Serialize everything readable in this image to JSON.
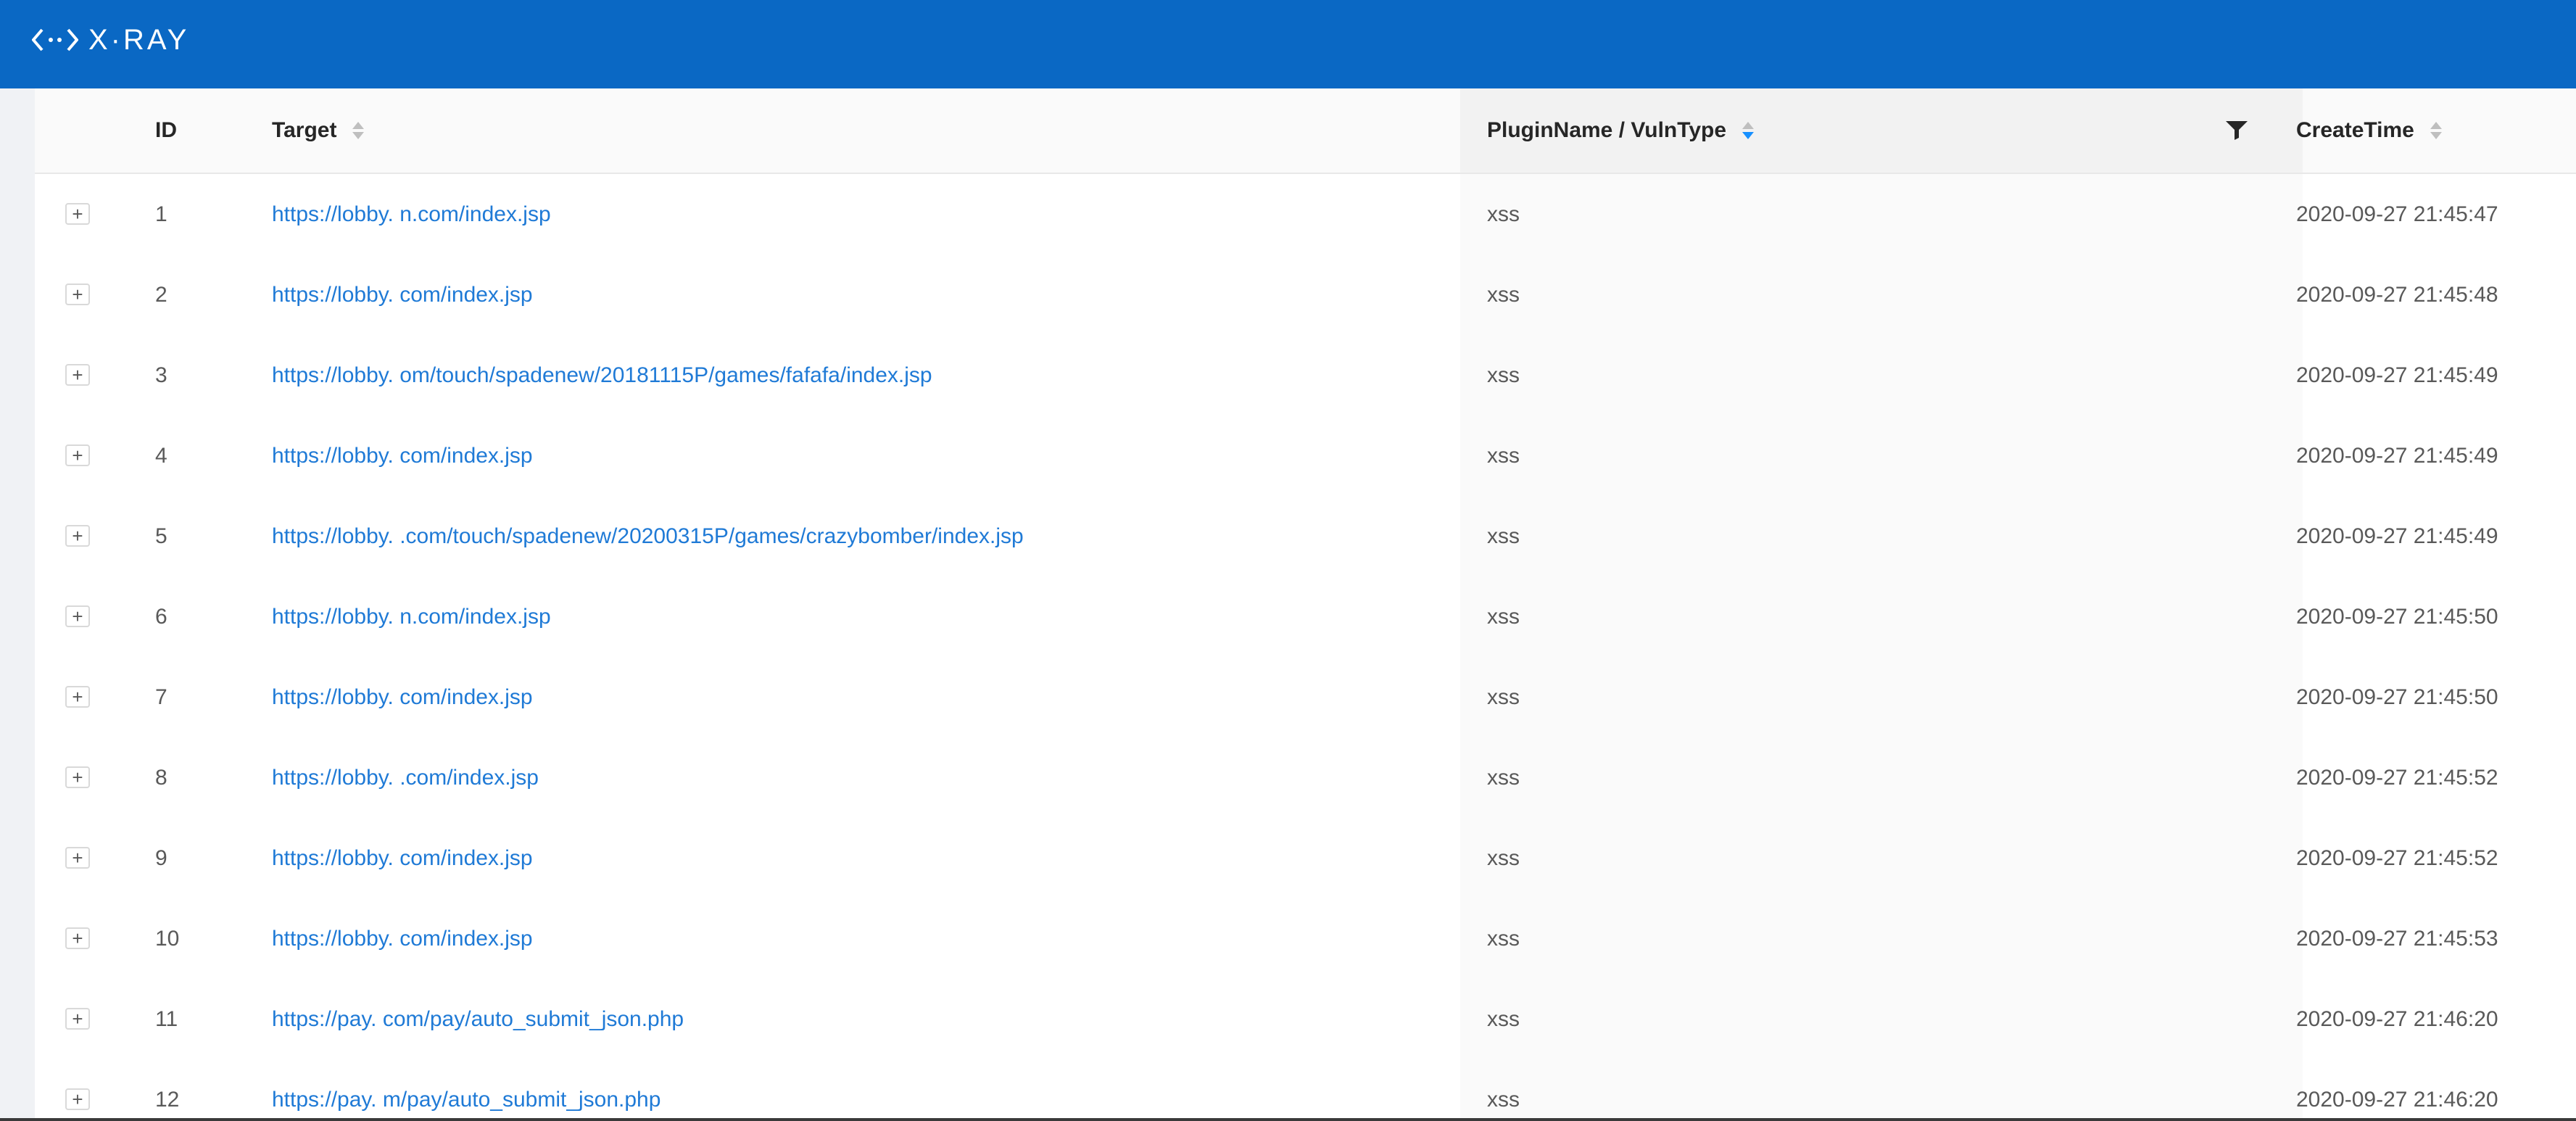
{
  "app": {
    "logo_text": "X·RAY"
  },
  "table": {
    "columns": {
      "id": "ID",
      "target": "Target",
      "plugin": "PluginName / VulnType",
      "create_time": "CreateTime"
    },
    "expand_symbol": "+",
    "rows": [
      {
        "id": "1",
        "target": "https://lobby.          n.com/index.jsp",
        "plugin": "xss",
        "time": "2020-09-27 21:45:47"
      },
      {
        "id": "2",
        "target": "https://lobby.           com/index.jsp",
        "plugin": "xss",
        "time": "2020-09-27 21:45:48"
      },
      {
        "id": "3",
        "target": "https://lobby.          om/touch/spadenew/20181115P/games/fafafa/index.jsp",
        "plugin": "xss",
        "time": "2020-09-27 21:45:49"
      },
      {
        "id": "4",
        "target": "https://lobby.          com/index.jsp",
        "plugin": "xss",
        "time": "2020-09-27 21:45:49"
      },
      {
        "id": "5",
        "target": "https://lobby.          .com/touch/spadenew/20200315P/games/crazybomber/index.jsp",
        "plugin": "xss",
        "time": "2020-09-27 21:45:49"
      },
      {
        "id": "6",
        "target": "https://lobby.          n.com/index.jsp",
        "plugin": "xss",
        "time": "2020-09-27 21:45:50"
      },
      {
        "id": "7",
        "target": "https://lobby.          com/index.jsp",
        "plugin": "xss",
        "time": "2020-09-27 21:45:50"
      },
      {
        "id": "8",
        "target": "https://lobby.          .com/index.jsp",
        "plugin": "xss",
        "time": "2020-09-27 21:45:52"
      },
      {
        "id": "9",
        "target": "https://lobby.          com/index.jsp",
        "plugin": "xss",
        "time": "2020-09-27 21:45:52"
      },
      {
        "id": "10",
        "target": "https://lobby.          com/index.jsp",
        "plugin": "xss",
        "time": "2020-09-27 21:45:53"
      },
      {
        "id": "11",
        "target": "https://pay.        com/pay/auto_submit_json.php",
        "plugin": "xss",
        "time": "2020-09-27 21:46:20"
      },
      {
        "id": "12",
        "target": "https://pay.        m/pay/auto_submit_json.php",
        "plugin": "xss",
        "time": "2020-09-27 21:46:20"
      }
    ]
  },
  "colors": {
    "header_bar": "#0a68c4",
    "link": "#1f7ad6",
    "sort_active": "#1890ff"
  }
}
